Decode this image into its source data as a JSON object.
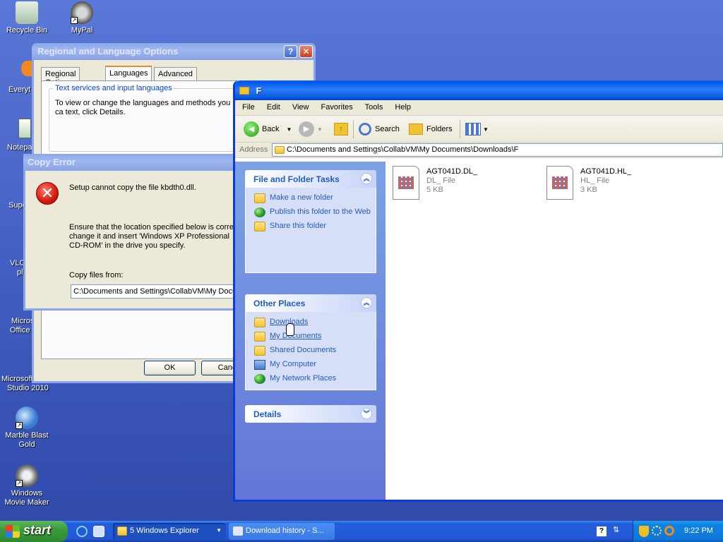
{
  "desktop": {
    "icons": [
      {
        "label": "Recycle Bin"
      },
      {
        "label": "MyPal"
      },
      {
        "label": "Marble Blast Gold"
      },
      {
        "label": "Windows Movie Maker"
      }
    ],
    "partial_labels": [
      "Everyt",
      "Notepa",
      "Supe",
      "VLC",
      "pl",
      "Micros",
      "Office",
      "Microsoft",
      "Studio 2010"
    ]
  },
  "regional": {
    "title": "Regional and Language Options",
    "tabs": [
      "Regional Options",
      "Languages",
      "Advanced"
    ],
    "group_label": "Text services and input languages",
    "group_desc": "To view or change the languages and methods you ca text, click Details.",
    "ok_label": "OK",
    "cancel_label": "Canc"
  },
  "copy_error": {
    "title": "Copy Error",
    "line1": "Setup cannot copy the file kbdth0.dll.",
    "line2": "Ensure that the location specified below is correc change it and insert 'Windows XP Professional CD-ROM' in the drive you specify.",
    "copy_from_label": "Copy files from:",
    "copy_from_value": "C:\\Documents and Settings\\CollabVM\\My Docu"
  },
  "explorer": {
    "title": "F",
    "menu": [
      "File",
      "Edit",
      "View",
      "Favorites",
      "Tools",
      "Help"
    ],
    "toolbar": {
      "back": "Back",
      "search": "Search",
      "folders": "Folders"
    },
    "address_label": "Address",
    "address_value": "C:\\Documents and Settings\\CollabVM\\My Documents\\Downloads\\F",
    "file_tasks": {
      "title": "File and Folder Tasks",
      "items": [
        "Make a new folder",
        "Publish this folder to the Web",
        "Share this folder"
      ]
    },
    "other_places": {
      "title": "Other Places",
      "items": [
        "Downloads",
        "My Documents",
        "Shared Documents",
        "My Computer",
        "My Network Places"
      ]
    },
    "details": {
      "title": "Details"
    },
    "files": [
      {
        "name": "AGT041D.DL_",
        "type": "DL_ File",
        "size": "5 KB"
      },
      {
        "name": "AGT041D.HL_",
        "type": "HL_ File",
        "size": "3 KB"
      }
    ]
  },
  "taskbar": {
    "start_label": "start",
    "tasks": [
      {
        "label": "5 Windows Explorer"
      },
      {
        "label": "Download history - S..."
      }
    ],
    "clock": "9:22 PM"
  }
}
